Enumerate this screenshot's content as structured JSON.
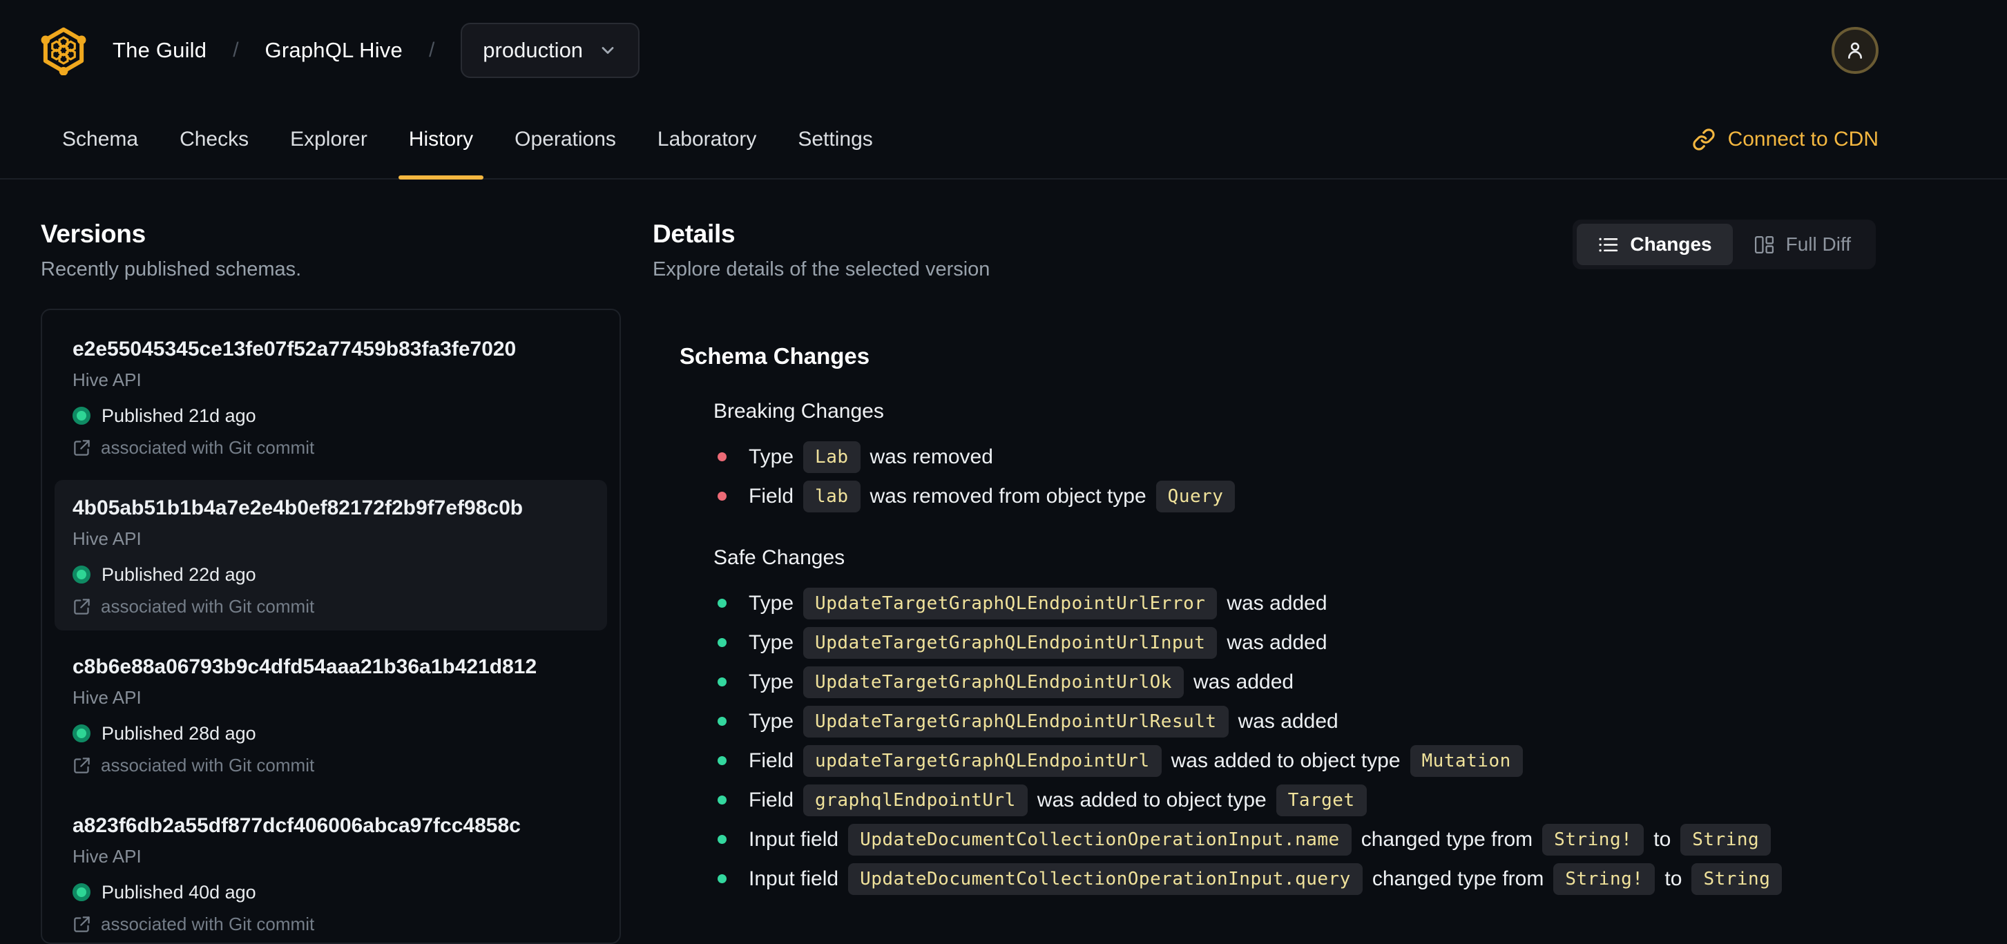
{
  "header": {
    "org": "The Guild",
    "project": "GraphQL Hive",
    "separator": "/",
    "target_selector": {
      "value": "production"
    },
    "tabs": [
      {
        "label": "Schema",
        "active": false
      },
      {
        "label": "Checks",
        "active": false
      },
      {
        "label": "Explorer",
        "active": false
      },
      {
        "label": "History",
        "active": true
      },
      {
        "label": "Operations",
        "active": false
      },
      {
        "label": "Laboratory",
        "active": false
      },
      {
        "label": "Settings",
        "active": false
      }
    ],
    "connect_cdn_label": "Connect to CDN"
  },
  "versions": {
    "title": "Versions",
    "subtitle": "Recently published schemas.",
    "items": [
      {
        "hash": "e2e55045345ce13fe07f52a77459b83fa3fe7020",
        "service": "Hive API",
        "published": "Published 21d ago",
        "git_note": "associated with Git commit",
        "selected": false
      },
      {
        "hash": "4b05ab51b1b4a7e2e4b0ef82172f2b9f7ef98c0b",
        "service": "Hive API",
        "published": "Published 22d ago",
        "git_note": "associated with Git commit",
        "selected": true
      },
      {
        "hash": "c8b6e88a06793b9c4dfd54aaa21b36a1b421d812",
        "service": "Hive API",
        "published": "Published 28d ago",
        "git_note": "associated with Git commit",
        "selected": false
      },
      {
        "hash": "a823f6db2a55df877dcf406006abca97fcc4858c",
        "service": "Hive API",
        "published": "Published 40d ago",
        "git_note": "associated with Git commit",
        "selected": false
      }
    ]
  },
  "details": {
    "title": "Details",
    "subtitle": "Explore details of the selected version",
    "view_toggle": {
      "changes_label": "Changes",
      "full_diff_label": "Full Diff",
      "active": "Changes"
    },
    "schema_changes_title": "Schema Changes",
    "breaking": {
      "title": "Breaking Changes",
      "items": [
        [
          {
            "k": "t",
            "v": "Type"
          },
          {
            "k": "c",
            "v": "Lab"
          },
          {
            "k": "t",
            "v": "was removed"
          }
        ],
        [
          {
            "k": "t",
            "v": "Field"
          },
          {
            "k": "c",
            "v": "lab"
          },
          {
            "k": "t",
            "v": "was removed from object type"
          },
          {
            "k": "c",
            "v": "Query"
          }
        ]
      ]
    },
    "safe": {
      "title": "Safe Changes",
      "items": [
        [
          {
            "k": "t",
            "v": "Type"
          },
          {
            "k": "c",
            "v": "UpdateTargetGraphQLEndpointUrlError"
          },
          {
            "k": "t",
            "v": "was added"
          }
        ],
        [
          {
            "k": "t",
            "v": "Type"
          },
          {
            "k": "c",
            "v": "UpdateTargetGraphQLEndpointUrlInput"
          },
          {
            "k": "t",
            "v": "was added"
          }
        ],
        [
          {
            "k": "t",
            "v": "Type"
          },
          {
            "k": "c",
            "v": "UpdateTargetGraphQLEndpointUrlOk"
          },
          {
            "k": "t",
            "v": "was added"
          }
        ],
        [
          {
            "k": "t",
            "v": "Type"
          },
          {
            "k": "c",
            "v": "UpdateTargetGraphQLEndpointUrlResult"
          },
          {
            "k": "t",
            "v": "was added"
          }
        ],
        [
          {
            "k": "t",
            "v": "Field"
          },
          {
            "k": "c",
            "v": "updateTargetGraphQLEndpointUrl"
          },
          {
            "k": "t",
            "v": "was added to object type"
          },
          {
            "k": "c",
            "v": "Mutation"
          }
        ],
        [
          {
            "k": "t",
            "v": "Field"
          },
          {
            "k": "c",
            "v": "graphqlEndpointUrl"
          },
          {
            "k": "t",
            "v": "was added to object type"
          },
          {
            "k": "c",
            "v": "Target"
          }
        ],
        [
          {
            "k": "t",
            "v": "Input field"
          },
          {
            "k": "c",
            "v": "UpdateDocumentCollectionOperationInput.name"
          },
          {
            "k": "t",
            "v": "changed type from"
          },
          {
            "k": "c",
            "v": "String!"
          },
          {
            "k": "t",
            "v": "to"
          },
          {
            "k": "c",
            "v": "String"
          }
        ],
        [
          {
            "k": "t",
            "v": "Input field"
          },
          {
            "k": "c",
            "v": "UpdateDocumentCollectionOperationInput.query"
          },
          {
            "k": "t",
            "v": "changed type from"
          },
          {
            "k": "c",
            "v": "String!"
          },
          {
            "k": "t",
            "v": "to"
          },
          {
            "k": "c",
            "v": "String"
          }
        ]
      ]
    }
  },
  "colors": {
    "background": "#0a0d12",
    "accent_yellow": "#f4b740",
    "breaking_bullet": "#ec6a76",
    "safe_bullet": "#33d79e",
    "code_text": "#f0e29b",
    "code_background": "#25272d",
    "published_dot": "#2ed695"
  }
}
